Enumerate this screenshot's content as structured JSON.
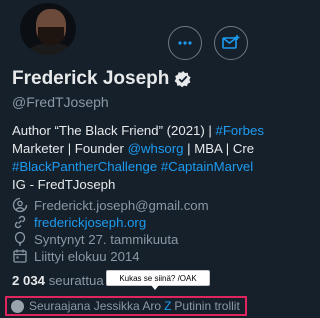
{
  "profile": {
    "name": "Frederick Joseph",
    "handle": "@FredTJoseph"
  },
  "bio": {
    "line1_text": "Author “The Black Friend” (2021) | ",
    "line1_tag": "#Forbes",
    "line2_text": " Marketer | Founder ",
    "line2_mention": "@whsorg",
    "line2_rest": " | MBA | Cre",
    "line3_tag1": "#BlackPantherChallenge",
    "line3_tag2": "#CaptainMarvel",
    "line4": "IG - FredTJoseph"
  },
  "meta": {
    "email": "Frederickt.joseph@gmail.com",
    "website": "frederickjoseph.org",
    "birth": "Syntynyt 27. tammikuuta",
    "joined": "Liittyi elokuu 2014"
  },
  "stats": {
    "following_count": "2 034",
    "following_label": "seurattua"
  },
  "tooltip": {
    "text": "Kukas se siinä? /OAK"
  },
  "followers": {
    "prefix": "Seuraajana Jessikka Aro",
    "separator": "Z",
    "suffix": "Putinin trollit"
  },
  "colors": {
    "background": "#15202b",
    "accent": "#1d9bf0",
    "highlight_border": "#e0245e"
  },
  "icons": [
    "more-horizontal-icon",
    "mail-plus-icon",
    "verified-badge-icon",
    "mail-icon",
    "link-icon",
    "balloon-icon",
    "calendar-icon"
  ]
}
